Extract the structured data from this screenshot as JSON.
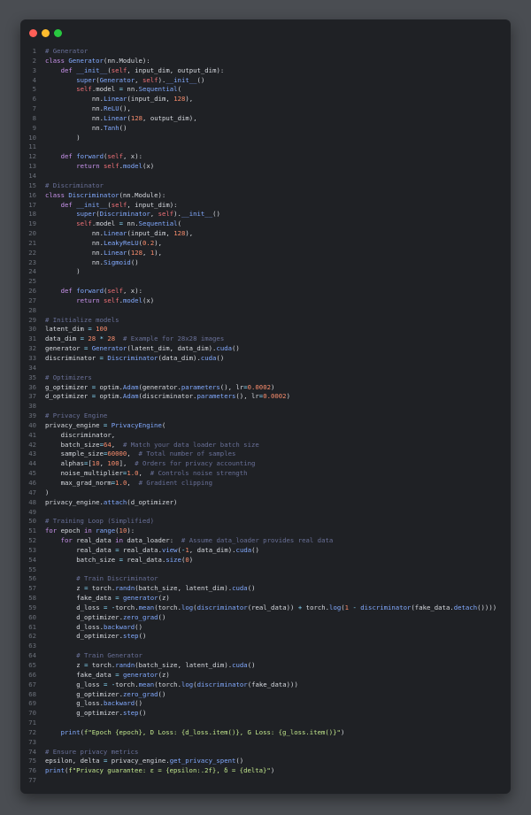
{
  "window": {
    "controls": {
      "close_color": "#ff5f57",
      "minimize_color": "#febc2e",
      "maximize_color": "#28c840"
    }
  },
  "code_lines": [
    {
      "n": "1",
      "text": "# Generator",
      "kind": "comment"
    },
    {
      "n": "2",
      "text": "class Generator(nn.Module):",
      "kind": "code"
    },
    {
      "n": "3",
      "text": "    def __init__(self, input_dim, output_dim):",
      "kind": "code"
    },
    {
      "n": "4",
      "text": "        super(Generator, self).__init__()",
      "kind": "code"
    },
    {
      "n": "5",
      "text": "        self.model = nn.Sequential(",
      "kind": "code"
    },
    {
      "n": "6",
      "text": "            nn.Linear(input_dim, 128),",
      "kind": "code"
    },
    {
      "n": "7",
      "text": "            nn.ReLU(),",
      "kind": "code"
    },
    {
      "n": "8",
      "text": "            nn.Linear(128, output_dim),",
      "kind": "code"
    },
    {
      "n": "9",
      "text": "            nn.Tanh()",
      "kind": "code"
    },
    {
      "n": "10",
      "text": "        )",
      "kind": "code"
    },
    {
      "n": "11",
      "text": "",
      "kind": "code"
    },
    {
      "n": "12",
      "text": "    def forward(self, x):",
      "kind": "code"
    },
    {
      "n": "13",
      "text": "        return self.model(x)",
      "kind": "code"
    },
    {
      "n": "14",
      "text": "",
      "kind": "code"
    },
    {
      "n": "15",
      "text": "# Discriminator",
      "kind": "comment"
    },
    {
      "n": "16",
      "text": "class Discriminator(nn.Module):",
      "kind": "code"
    },
    {
      "n": "17",
      "text": "    def __init__(self, input_dim):",
      "kind": "code"
    },
    {
      "n": "18",
      "text": "        super(Discriminator, self).__init__()",
      "kind": "code"
    },
    {
      "n": "19",
      "text": "        self.model = nn.Sequential(",
      "kind": "code"
    },
    {
      "n": "20",
      "text": "            nn.Linear(input_dim, 128),",
      "kind": "code"
    },
    {
      "n": "21",
      "text": "            nn.LeakyReLU(0.2),",
      "kind": "code"
    },
    {
      "n": "22",
      "text": "            nn.Linear(128, 1),",
      "kind": "code"
    },
    {
      "n": "23",
      "text": "            nn.Sigmoid()",
      "kind": "code"
    },
    {
      "n": "24",
      "text": "        )",
      "kind": "code"
    },
    {
      "n": "25",
      "text": "",
      "kind": "code"
    },
    {
      "n": "26",
      "text": "    def forward(self, x):",
      "kind": "code"
    },
    {
      "n": "27",
      "text": "        return self.model(x)",
      "kind": "code"
    },
    {
      "n": "28",
      "text": "",
      "kind": "code"
    },
    {
      "n": "29",
      "text": "# Initialize models",
      "kind": "comment"
    },
    {
      "n": "30",
      "text": "latent_dim = 100",
      "kind": "code"
    },
    {
      "n": "31",
      "text": "data_dim = 28 * 28  # Example for 28x28 images",
      "kind": "code"
    },
    {
      "n": "32",
      "text": "generator = Generator(latent_dim, data_dim).cuda()",
      "kind": "code"
    },
    {
      "n": "33",
      "text": "discriminator = Discriminator(data_dim).cuda()",
      "kind": "code"
    },
    {
      "n": "34",
      "text": "",
      "kind": "code"
    },
    {
      "n": "35",
      "text": "# Optimizers",
      "kind": "comment"
    },
    {
      "n": "36",
      "text": "g_optimizer = optim.Adam(generator.parameters(), lr=0.0002)",
      "kind": "code"
    },
    {
      "n": "37",
      "text": "d_optimizer = optim.Adam(discriminator.parameters(), lr=0.0002)",
      "kind": "code"
    },
    {
      "n": "38",
      "text": "",
      "kind": "code"
    },
    {
      "n": "39",
      "text": "# Privacy Engine",
      "kind": "comment"
    },
    {
      "n": "40",
      "text": "privacy_engine = PrivacyEngine(",
      "kind": "code"
    },
    {
      "n": "41",
      "text": "    discriminator,",
      "kind": "code"
    },
    {
      "n": "42",
      "text": "    batch_size=64,  # Match your data loader batch size",
      "kind": "code"
    },
    {
      "n": "43",
      "text": "    sample_size=60000,  # Total number of samples",
      "kind": "code"
    },
    {
      "n": "44",
      "text": "    alphas=[10, 100],  # Orders for privacy accounting",
      "kind": "code"
    },
    {
      "n": "45",
      "text": "    noise_multiplier=1.0,  # Controls noise strength",
      "kind": "code"
    },
    {
      "n": "46",
      "text": "    max_grad_norm=1.0,  # Gradient clipping",
      "kind": "code"
    },
    {
      "n": "47",
      "text": ")",
      "kind": "code"
    },
    {
      "n": "48",
      "text": "privacy_engine.attach(d_optimizer)",
      "kind": "code"
    },
    {
      "n": "49",
      "text": "",
      "kind": "code"
    },
    {
      "n": "50",
      "text": "# Training Loop (Simplified)",
      "kind": "comment"
    },
    {
      "n": "51",
      "text": "for epoch in range(10):",
      "kind": "code"
    },
    {
      "n": "52",
      "text": "    for real_data in data_loader:  # Assume data_loader provides real data",
      "kind": "code"
    },
    {
      "n": "53",
      "text": "        real_data = real_data.view(-1, data_dim).cuda()",
      "kind": "code"
    },
    {
      "n": "54",
      "text": "        batch_size = real_data.size(0)",
      "kind": "code"
    },
    {
      "n": "55",
      "text": "",
      "kind": "code"
    },
    {
      "n": "56",
      "text": "        # Train Discriminator",
      "kind": "comment"
    },
    {
      "n": "57",
      "text": "        z = torch.randn(batch_size, latent_dim).cuda()",
      "kind": "code"
    },
    {
      "n": "58",
      "text": "        fake_data = generator(z)",
      "kind": "code"
    },
    {
      "n": "59",
      "text": "        d_loss = -torch.mean(torch.log(discriminator(real_data)) + torch.log(1 - discriminator(fake_data.detach())))",
      "kind": "code"
    },
    {
      "n": "60",
      "text": "        d_optimizer.zero_grad()",
      "kind": "code"
    },
    {
      "n": "61",
      "text": "        d_loss.backward()",
      "kind": "code"
    },
    {
      "n": "62",
      "text": "        d_optimizer.step()",
      "kind": "code"
    },
    {
      "n": "63",
      "text": "",
      "kind": "code"
    },
    {
      "n": "64",
      "text": "        # Train Generator",
      "kind": "comment"
    },
    {
      "n": "65",
      "text": "        z = torch.randn(batch_size, latent_dim).cuda()",
      "kind": "code"
    },
    {
      "n": "66",
      "text": "        fake_data = generator(z)",
      "kind": "code"
    },
    {
      "n": "67",
      "text": "        g_loss = -torch.mean(torch.log(discriminator(fake_data)))",
      "kind": "code"
    },
    {
      "n": "68",
      "text": "        g_optimizer.zero_grad()",
      "kind": "code"
    },
    {
      "n": "69",
      "text": "        g_loss.backward()",
      "kind": "code"
    },
    {
      "n": "70",
      "text": "        g_optimizer.step()",
      "kind": "code"
    },
    {
      "n": "71",
      "text": "",
      "kind": "code"
    },
    {
      "n": "72",
      "text": "    print(f\"Epoch {epoch}, D Loss: {d_loss.item()}, G Loss: {g_loss.item()}\")",
      "kind": "code"
    },
    {
      "n": "73",
      "text": "",
      "kind": "code"
    },
    {
      "n": "74",
      "text": "# Ensure privacy metrics",
      "kind": "comment"
    },
    {
      "n": "75",
      "text": "epsilon, delta = privacy_engine.get_privacy_spent()",
      "kind": "code"
    },
    {
      "n": "76",
      "text": "print(f\"Privacy guarantee: ε = {epsilon:.2f}, δ = {delta}\")",
      "kind": "code"
    },
    {
      "n": "77",
      "text": "",
      "kind": "code"
    }
  ],
  "colors": {
    "page_background": "#4a4d52",
    "editor_background": "#1f2125",
    "text": "#d7dae0",
    "line_number": "#6b707a",
    "keyword": "#c792ea",
    "class_name": "#82aaff",
    "string": "#c3e88d",
    "number": "#f78c6c",
    "comment": "#697098",
    "self": "#f07178",
    "operator": "#89ddff"
  }
}
